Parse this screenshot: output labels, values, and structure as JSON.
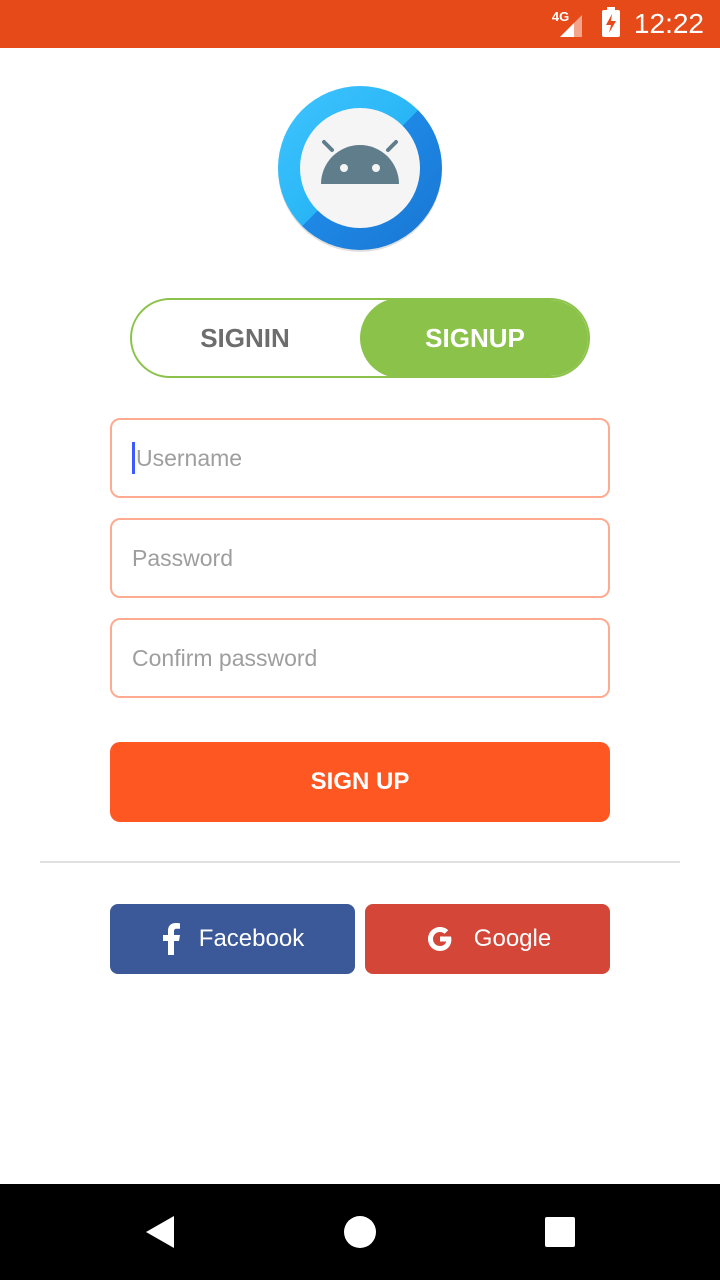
{
  "status_bar": {
    "network_label": "4G",
    "time": "12:22",
    "icons": [
      "signal-icon",
      "battery-charging-icon"
    ]
  },
  "logo": {
    "icon": "android-icon"
  },
  "tabs": [
    {
      "label": "SIGNIN",
      "selected": false
    },
    {
      "label": "SIGNUP",
      "selected": true
    }
  ],
  "form": {
    "username_placeholder": "Username",
    "password_placeholder": "Password",
    "confirm_placeholder": "Confirm password",
    "submit_label": "SIGN UP"
  },
  "social": {
    "facebook_label": "Facebook",
    "google_label": "Google"
  },
  "nav_bar": {
    "icons": [
      "back-icon",
      "home-icon",
      "recents-icon"
    ]
  },
  "colors": {
    "status_bar": "#e64a19",
    "accent_green": "#8bc34a",
    "primary_orange": "#ff5722",
    "field_border": "#ffab91",
    "facebook": "#3b5998",
    "google": "#d44638"
  }
}
